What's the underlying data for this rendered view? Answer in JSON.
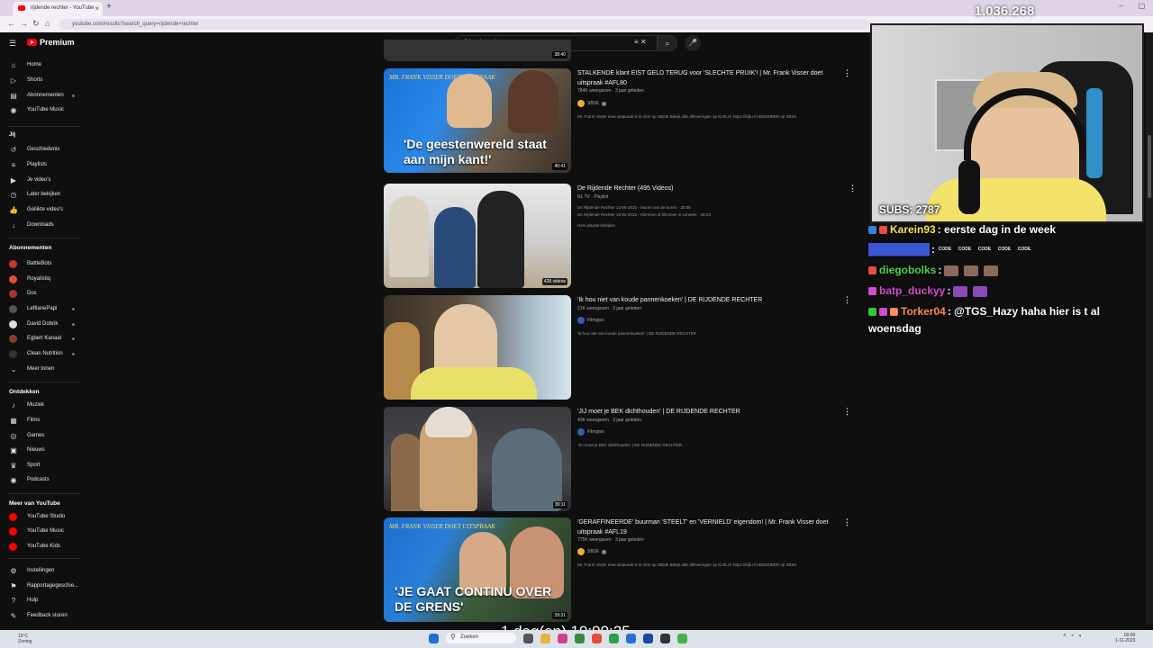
{
  "browser": {
    "tab_title": "rijdende rechter - YouTube",
    "url": "youtube.com/results?search_query=rijdende+rechter"
  },
  "youtube": {
    "logo_label": "Premium",
    "search_value": "rijdende rechter"
  },
  "sidebar": {
    "main": [
      {
        "label": "Home",
        "icon": "home-icon"
      },
      {
        "label": "Shorts",
        "icon": "shorts-icon"
      },
      {
        "label": "Abonnementen",
        "icon": "subscriptions-icon"
      },
      {
        "label": "YouTube Music",
        "icon": "music-icon"
      }
    ],
    "you_heading": "Jij",
    "you": [
      {
        "label": "Geschiedenis",
        "icon": "history-icon"
      },
      {
        "label": "Playlists",
        "icon": "playlist-icon"
      },
      {
        "label": "Je video's",
        "icon": "video-icon"
      },
      {
        "label": "Later bekijken",
        "icon": "clock-icon"
      },
      {
        "label": "Geliikte video's",
        "icon": "thumbs-up-icon"
      },
      {
        "label": "Downloads",
        "icon": "download-icon"
      }
    ],
    "subs_heading": "Abonnementen",
    "subs": [
      {
        "label": "BattleBots",
        "color": "#c0392b"
      },
      {
        "label": "Royalistiq",
        "color": "#e74c3c"
      },
      {
        "label": "Dos",
        "color": "#a93226"
      },
      {
        "label": "LeftlanePapi",
        "color": "#555555"
      },
      {
        "label": "David Dobrik",
        "color": "#dddddd"
      },
      {
        "label": "Egbert Kanaal",
        "color": "#8e3b2e"
      },
      {
        "label": "Clean Nutrition",
        "color": "#333333"
      },
      {
        "label": "Meer tonen",
        "color": ""
      }
    ],
    "explore_heading": "Ontdekken",
    "explore": [
      {
        "label": "Muziek",
        "icon": "music-note-icon"
      },
      {
        "label": "Films",
        "icon": "film-icon"
      },
      {
        "label": "Games",
        "icon": "gamepad-icon"
      },
      {
        "label": "Nieuws",
        "icon": "news-icon"
      },
      {
        "label": "Sport",
        "icon": "trophy-icon"
      },
      {
        "label": "Podcasts",
        "icon": "podcast-icon"
      }
    ],
    "more_heading": "Meer van YouTube",
    "more": [
      {
        "label": "YouTube Studio",
        "color": "#ff0000"
      },
      {
        "label": "YouTube Music",
        "color": "#ff0000"
      },
      {
        "label": "YouTube Kids",
        "color": "#ff0000"
      }
    ],
    "footer": [
      {
        "label": "Instellingen",
        "icon": "gear-icon"
      },
      {
        "label": "Rapportagegeschie...",
        "icon": "flag-icon"
      },
      {
        "label": "Hulp",
        "icon": "help-icon"
      },
      {
        "label": "Feedback sturen",
        "icon": "feedback-icon"
      }
    ]
  },
  "results": [
    {
      "title": "STALKENDE klant EIST GELD TERUG voor 'SLECHTE PRUIK'! | Mr. Frank Visser doet uitspraak #AFL80",
      "meta": "784K weergaven · 3 jaar geleden",
      "channel": "SBS6",
      "desc": "Mr. Frank Visser doet uitspraak is te zien op SBS6! Bekijk alle afleveringen op KIJK.nl: https://kijk.nl ABONNEER op SBS6",
      "thumb_text": "'De geestenwereld staat aan mijn kant!'",
      "thumb_brand": "MR. FRANK VISSER DOET UITSPRAAK",
      "duration": "40:41"
    },
    {
      "title": "De Rijdende Rechter (495 Videos)",
      "meta": "NL TV · Playlist",
      "desc1": "De Rijdende Rechter 13-06-2015 - Muren van de buren · 30:06",
      "desc2": "De Rijdende Rechter 18-02-2015 - Klimmen of klimmen in Limmen · 29:23",
      "desc3": "Hele playlist bekijken",
      "stack": "428 videos"
    },
    {
      "title": "'Ik hou niet van koude pannenkoeken' | DE RIJDENDE RECHTER",
      "meta": "21K weergaven · 3 jaar geleden",
      "channel": "Filmpjes",
      "desc": "'Ik hou niet van koude pannenkoeken' | DE RIJDENDE RECHTER"
    },
    {
      "title": "'JIJ moet je BEK dichthouden' | DE RIJDENDE RECHTER",
      "meta": "43K weergaven · 3 jaar geleden",
      "channel": "Filmpjes",
      "desc": "'JIJ moet je BEK dichthouden' | DE RIJDENDE RECHTER",
      "duration": "30:11"
    },
    {
      "title": "'GERAFFINEERDE' buurman 'STEELT' en 'VERNIELD' eigendom! | Mr. Frank Visser doet uitspraak #AFL19",
      "meta": "775K weergaven · 3 jaar geleden",
      "channel": "SBS6",
      "desc": "Mr. Frank Visser doet uitspraak is te zien op SBS6! Bekijk alle afleveringen op KIJK.nl: https://kijk.nl ABONNEER op SBS6",
      "thumb_text": "'JE GAAT CONTINU OVER DE GRENS'",
      "thumb_brand": "MR. FRANK VISSER DOET UITSPRAAK",
      "duration": "39:31"
    }
  ],
  "top_partial_duration": "38:40",
  "stream": {
    "viewers": "1.036.268",
    "subs": "SUBS: 2787",
    "timer": "1 dag(en) 19:00:25",
    "chat": [
      {
        "user": "Karein93",
        "color": "#f3e15a",
        "text": ": eerste dag in de week"
      },
      {
        "user": "████████",
        "color": "#3c57d6",
        "text": ":",
        "codes": 5
      },
      {
        "user": "diegobolks",
        "color": "#4fd14f",
        "text": ":",
        "emotes": 3
      },
      {
        "user": "batp_duckyy",
        "color": "#d54ccf",
        "text": ":",
        "emotes": 2
      },
      {
        "user": "Torker04",
        "color": "#ff8a5c",
        "text": ": @TGS_Hazy haha hier is t al woensdag"
      }
    ],
    "code_word": "CODE"
  },
  "taskbar": {
    "weather_temp": "16°C",
    "weather_desc": "Zonnig",
    "search": "Zoeken",
    "time": "00:00",
    "date": "1-11-2023"
  }
}
